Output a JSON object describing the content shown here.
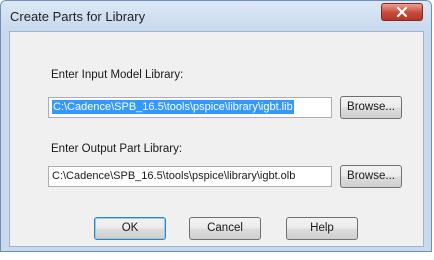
{
  "window": {
    "title": "Create Parts for Library"
  },
  "icons": {
    "close": "close-x-icon"
  },
  "input_library": {
    "label": "Enter Input Model Library:",
    "value": "C:\\Cadence\\SPB_16.5\\tools\\pspice\\library\\igbt.lib",
    "browse_label": "Browse..."
  },
  "output_library": {
    "label": "Enter Output Part Library:",
    "value": "C:\\Cadence\\SPB_16.5\\tools\\pspice\\library\\igbt.olb",
    "browse_label": "Browse..."
  },
  "buttons": {
    "ok": "OK",
    "cancel": "Cancel",
    "help": "Help"
  },
  "colors": {
    "selection": "#3399ff",
    "close_button": "#c9473a",
    "window_frame": "#c9daee"
  }
}
